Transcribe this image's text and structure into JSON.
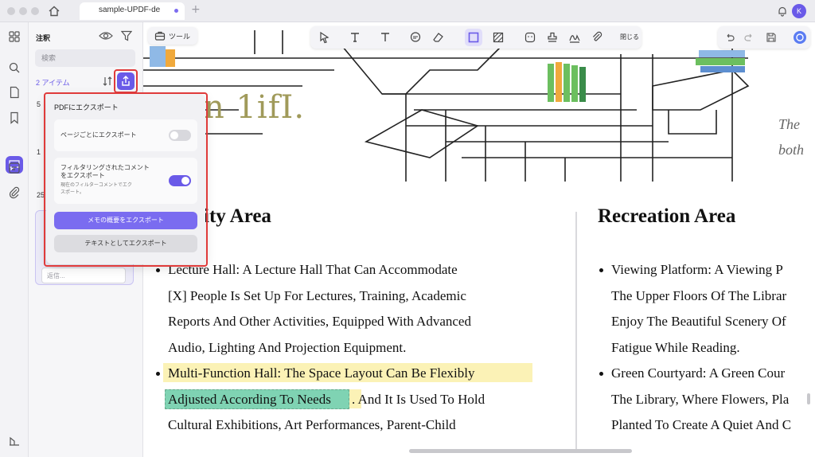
{
  "window": {
    "tab_title": "sample-UPDF-de"
  },
  "user": {
    "initial": "K"
  },
  "panel": {
    "title": "注釈",
    "search_placeholder": "検索",
    "count": "2 アイテム",
    "fragments": [
      "5",
      "1",
      "25"
    ],
    "reply_placeholder": "返信..."
  },
  "export_popup": {
    "title": "PDFにエクスポート",
    "per_page": {
      "label": "ページごとにエクスポート",
      "enabled": false
    },
    "filtered": {
      "label_line1": "フィルタリングされたコメント",
      "label_line2": "をエクスポート",
      "hint_line1": "現在のフィルターコメントでエク",
      "hint_line2": "スポート。",
      "enabled": true
    },
    "summary_button": "メモの概要をエクスポート",
    "text_button": "テキストとしてエクスポート"
  },
  "toolbar": {
    "tools_label": "ツール",
    "close_label": "閉じる"
  },
  "document": {
    "big_title": "n 1ifI.",
    "side_italic": [
      "The",
      "both"
    ],
    "left_heading": "ity Area",
    "right_heading": "Recreation Area",
    "left_lines": [
      "Lecture Hall: A Lecture Hall That Can Accommodate",
      "[X] People Is Set Up For Lectures, Training, Academic",
      "Reports And Other Activities, Equipped With Advanced",
      "Audio, Lighting And Projection Equipment.",
      "Multi-Function Hall: The Space Layout Can Be Flexibly",
      "Adjusted According To Needs",
      ". And It Is Used To Hold",
      "Cultural Exhibitions, Art Performances, Parent-Child"
    ],
    "right_lines": [
      "Viewing Platform: A Viewing P",
      "The Upper Floors Of The Librar",
      "Enjoy The Beautiful Scenery Of",
      "Fatigue While Reading.",
      "Green Courtyard: A Green Cour",
      "The Library, Where Flowers, Pla",
      "Planted To Create A Quiet And C"
    ]
  },
  "colors": {
    "accent": "#6a5ae8",
    "highlight_yellow": "#fbf2b6",
    "highlight_green": "#7fd3b3",
    "callout_red": "#e03b3b"
  }
}
